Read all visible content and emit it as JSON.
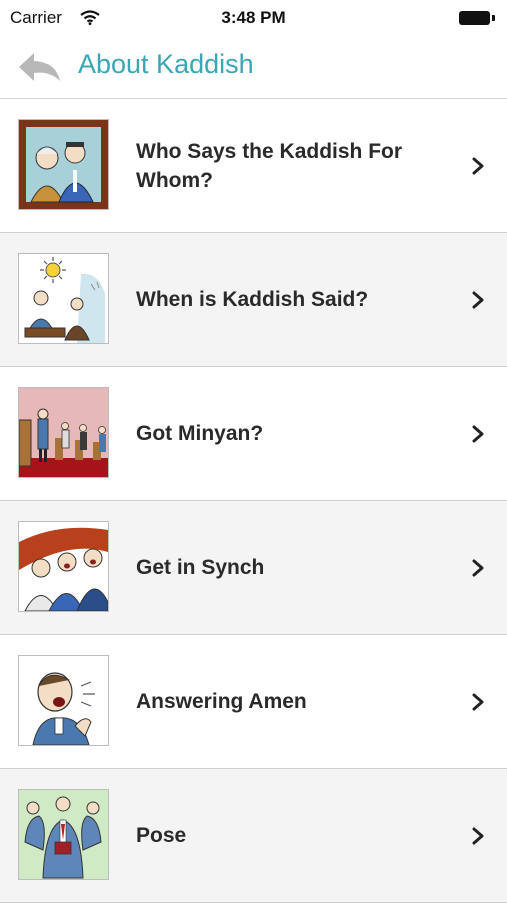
{
  "status_bar": {
    "carrier": "Carrier",
    "time": "3:48 PM",
    "icons": [
      "wifi-icon",
      "battery-icon"
    ]
  },
  "nav": {
    "title": "About Kaddish",
    "back_icon": "back-arrow-icon",
    "accent_color": "#3aa6b6"
  },
  "items": [
    {
      "label": "Who Says the Kaddish For Whom?",
      "icon": "couple-portrait-illustration"
    },
    {
      "label": "When is Kaddish Said?",
      "icon": "sun-morning-prayer-illustration"
    },
    {
      "label": "Got Minyan?",
      "icon": "synagogue-minyan-illustration"
    },
    {
      "label": "Get in Synch",
      "icon": "congregation-singing-illustration"
    },
    {
      "label": "Answering Amen",
      "icon": "man-answering-amen-illustration"
    },
    {
      "label": "Pose",
      "icon": "man-bowing-poses-illustration"
    }
  ]
}
